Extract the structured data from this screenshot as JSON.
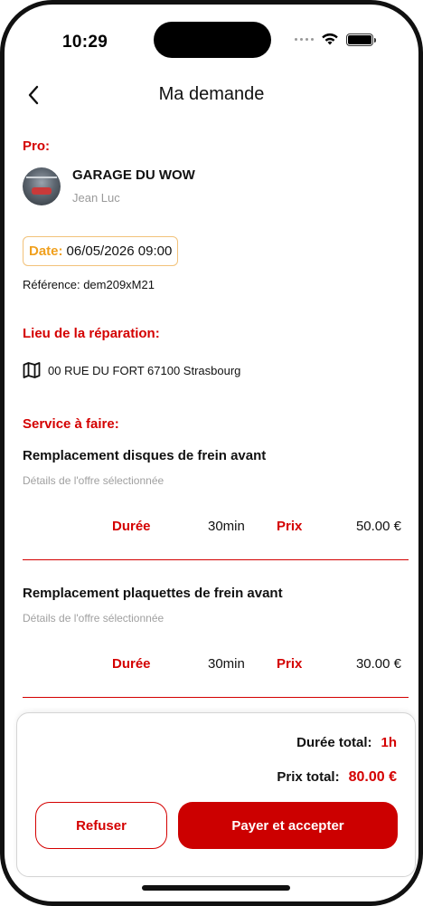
{
  "status_bar": {
    "time": "10:29"
  },
  "header": {
    "title": "Ma demande",
    "back_icon": "chevron-left-icon"
  },
  "pro": {
    "section_label": "Pro:",
    "name": "GARAGE DU WOW",
    "person": "Jean Luc"
  },
  "date": {
    "label": "Date:",
    "value": "06/05/2026 09:00"
  },
  "reference": "Référence: dem209xM21",
  "location": {
    "section_label": "Lieu de la réparation:",
    "address": "00 RUE DU FORT 67100 Strasbourg",
    "icon": "map-icon"
  },
  "services": {
    "section_label": "Service à faire:",
    "items": [
      {
        "title": "Remplacement disques de frein avant",
        "details": "Détails de l'offre sélectionnée",
        "duree_label": "Durée",
        "duree_value": "30min",
        "prix_label": "Prix",
        "prix_value": "50.00 €"
      },
      {
        "title": "Remplacement plaquettes de frein avant",
        "details": "Détails de l'offre sélectionnée",
        "duree_label": "Durée",
        "duree_value": "30min",
        "prix_label": "Prix",
        "prix_value": "30.00 €"
      }
    ]
  },
  "summary": {
    "duree_total_label": "Durée total:",
    "duree_total_value": "1h",
    "prix_total_label": "Prix total:",
    "prix_total_value": "80.00 €"
  },
  "actions": {
    "refuse_label": "Refuser",
    "accept_label": "Payer et accepter"
  },
  "colors": {
    "accent": "#d40000",
    "date_accent": "#f0a01e",
    "muted_text": "#9a9a9a"
  }
}
